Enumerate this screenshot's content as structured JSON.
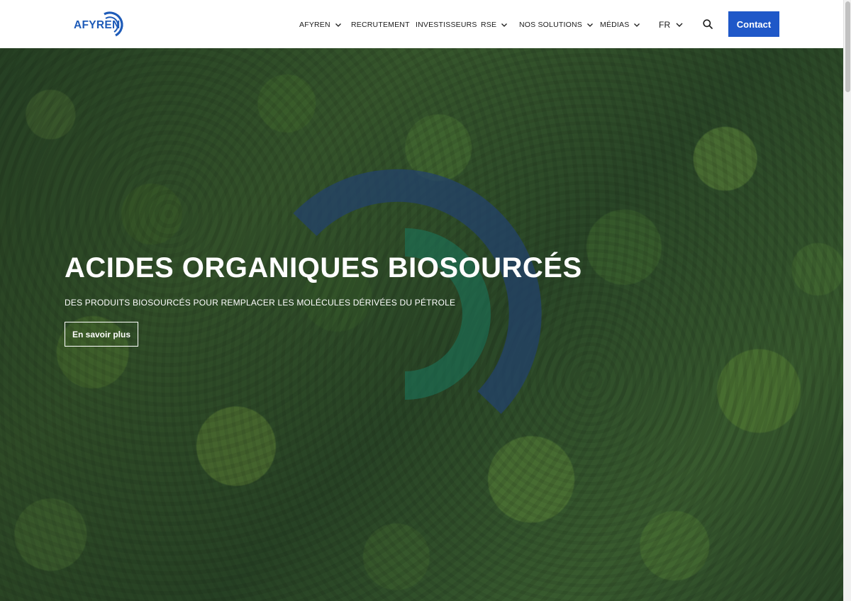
{
  "brand": {
    "name": "AFYREN",
    "accent": "#1f58c8"
  },
  "nav": {
    "items": [
      {
        "label": "AFYREN",
        "dropdown": true
      },
      {
        "label": "RECRUTEMENT",
        "dropdown": false
      },
      {
        "label": "INVESTISSEURS",
        "dropdown": false
      },
      {
        "label": "RSE",
        "dropdown": true
      },
      {
        "label": "NOS SOLUTIONS",
        "dropdown": true
      },
      {
        "label": "MÉDIAS",
        "dropdown": true
      }
    ],
    "language": "FR",
    "search_icon": "search-icon",
    "contact_label": "Contact"
  },
  "hero": {
    "title": "ACIDES ORGANIQUES BIOSOURCÉS",
    "subtitle": "DES PRODUITS BIOSOURCÉS POUR REMPLACER LES MOLÉCULES DÉRIVÉES DU PÉTROLE",
    "cta_label": "En savoir plus"
  }
}
